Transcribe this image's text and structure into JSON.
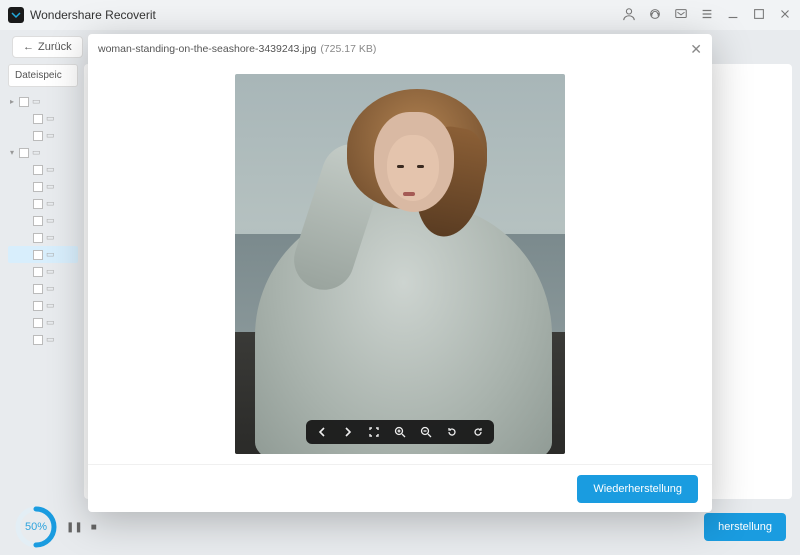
{
  "titlebar": {
    "app_name": "Wondershare Recoverit"
  },
  "toolbar": {
    "back_label": "Zurück"
  },
  "sidebar": {
    "tab_label": "Dateispeic",
    "rows": [
      {
        "arrow": "▸",
        "indent": false,
        "selected": false
      },
      {
        "arrow": "",
        "indent": true,
        "selected": false
      },
      {
        "arrow": "",
        "indent": true,
        "selected": false
      },
      {
        "arrow": "▾",
        "indent": false,
        "selected": false
      },
      {
        "arrow": "",
        "indent": true,
        "selected": false
      },
      {
        "arrow": "",
        "indent": true,
        "selected": false
      },
      {
        "arrow": "",
        "indent": true,
        "selected": false
      },
      {
        "arrow": "",
        "indent": true,
        "selected": false
      },
      {
        "arrow": "",
        "indent": true,
        "selected": false
      },
      {
        "arrow": "",
        "indent": true,
        "selected": true
      },
      {
        "arrow": "",
        "indent": true,
        "selected": false
      },
      {
        "arrow": "",
        "indent": true,
        "selected": false
      },
      {
        "arrow": "",
        "indent": true,
        "selected": false
      },
      {
        "arrow": "",
        "indent": true,
        "selected": false
      },
      {
        "arrow": "",
        "indent": true,
        "selected": false
      }
    ]
  },
  "footer": {
    "progress_pct": "50",
    "progress_label": "%",
    "recover_label": "herstellung"
  },
  "modal": {
    "filename": "woman-standing-on-the-seashore-3439243.jpg",
    "filesize": "(725.17 KB)",
    "recover_label": "Wiederherstellung"
  },
  "colors": {
    "accent": "#1a9ce0"
  }
}
